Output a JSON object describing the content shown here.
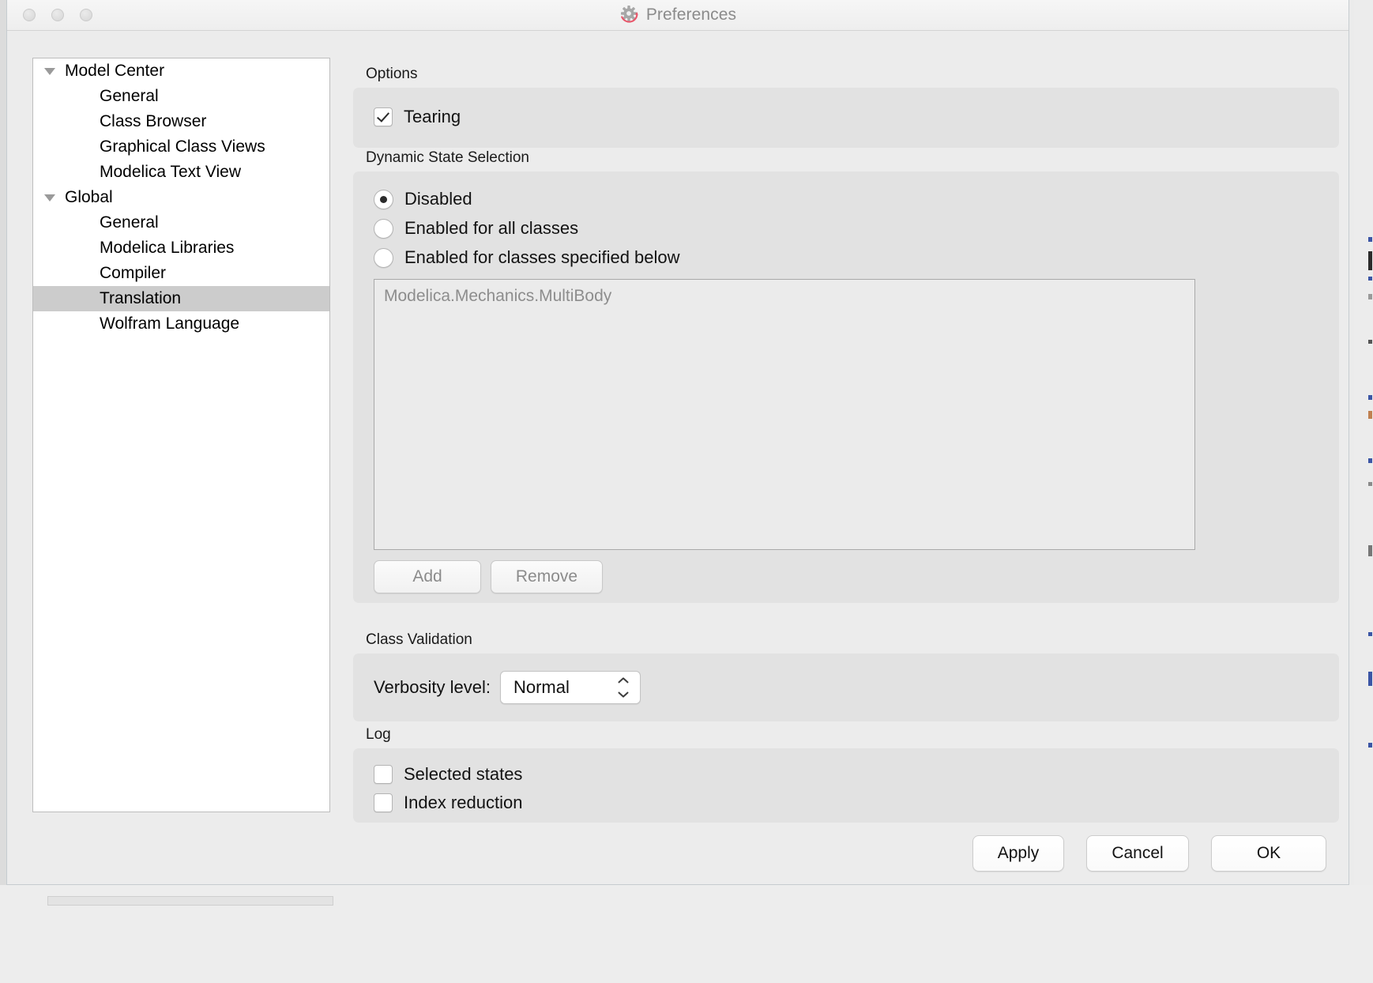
{
  "window": {
    "title": "Preferences",
    "title_icon": "gear-icon",
    "traffic_lights": [
      "close-button",
      "minimize-button",
      "maximize-button"
    ],
    "accent_red": "#e8566a",
    "selection_gray": "#cccccc"
  },
  "sidebar": {
    "items": [
      {
        "label": "Model Center",
        "level": 0,
        "expanded": true,
        "selected": false
      },
      {
        "label": "General",
        "level": 1,
        "expanded": false,
        "selected": false
      },
      {
        "label": "Class Browser",
        "level": 1,
        "expanded": false,
        "selected": false
      },
      {
        "label": "Graphical Class Views",
        "level": 1,
        "expanded": false,
        "selected": false
      },
      {
        "label": "Modelica Text View",
        "level": 1,
        "expanded": false,
        "selected": false
      },
      {
        "label": "Global",
        "level": 0,
        "expanded": true,
        "selected": false
      },
      {
        "label": "General",
        "level": 1,
        "expanded": false,
        "selected": false
      },
      {
        "label": "Modelica Libraries",
        "level": 1,
        "expanded": false,
        "selected": false
      },
      {
        "label": "Compiler",
        "level": 1,
        "expanded": false,
        "selected": false
      },
      {
        "label": "Translation",
        "level": 1,
        "expanded": false,
        "selected": true
      },
      {
        "label": "Wolfram Language",
        "level": 1,
        "expanded": false,
        "selected": false
      }
    ]
  },
  "options": {
    "group_label": "Options",
    "tearing": {
      "label": "Tearing",
      "checked": true
    }
  },
  "dynamic_state_selection": {
    "group_label": "Dynamic State Selection",
    "radios": [
      {
        "label": "Disabled",
        "selected": true
      },
      {
        "label": "Enabled for all classes",
        "selected": false
      },
      {
        "label": "Enabled for classes specified below",
        "selected": false
      }
    ],
    "class_list": [
      "Modelica.Mechanics.MultiBody"
    ],
    "add_button": "Add",
    "remove_button": "Remove",
    "buttons_disabled": true
  },
  "class_validation": {
    "group_label": "Class Validation",
    "verbosity_label": "Verbosity level:",
    "verbosity_value": "Normal",
    "verbosity_options": [
      "Normal"
    ]
  },
  "log": {
    "group_label": "Log",
    "checkboxes": [
      {
        "label": "Selected states",
        "checked": false
      },
      {
        "label": "Index reduction",
        "checked": false
      }
    ]
  },
  "footer": {
    "apply": "Apply",
    "cancel": "Cancel",
    "ok": "OK"
  }
}
